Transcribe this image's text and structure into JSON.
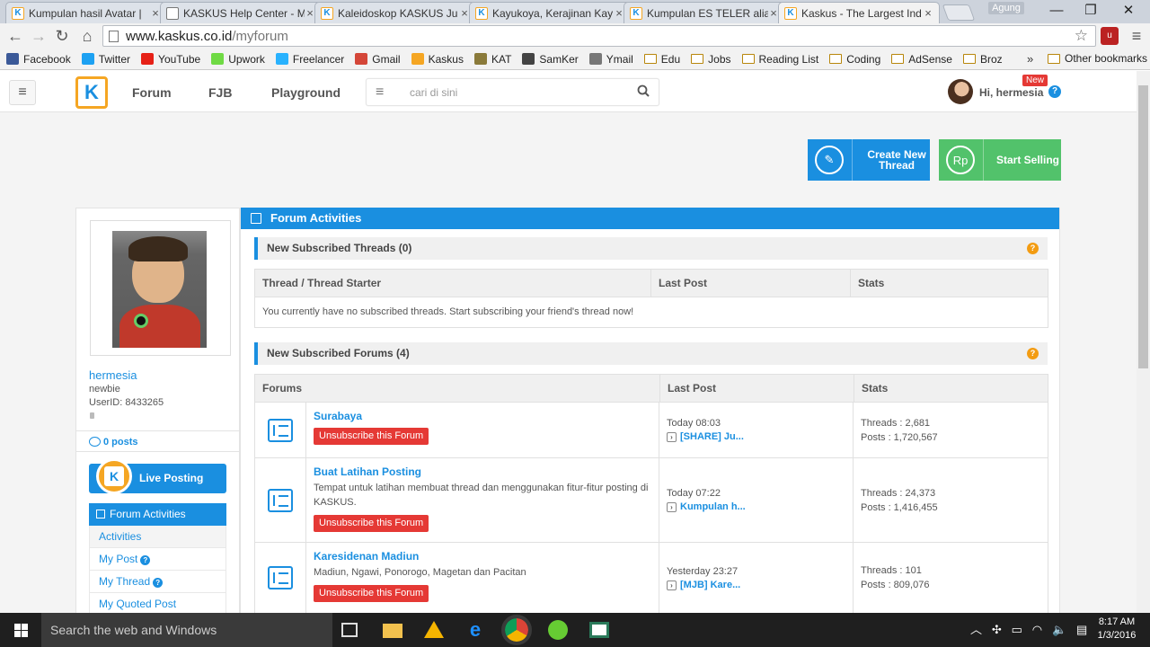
{
  "browser": {
    "tabs": [
      {
        "title": "Kumpulan hasil Avatar |",
        "icon": "kaskus-icon"
      },
      {
        "title": "KASKUS Help Center - M",
        "icon": "document-icon"
      },
      {
        "title": "Kaleidoskop KASKUS Ju",
        "icon": "kaskus-icon"
      },
      {
        "title": "Kayukoya, Kerajinan Kay",
        "icon": "kaskus-icon"
      },
      {
        "title": "Kumpulan ES TELER alias",
        "icon": "kaskus-icon"
      },
      {
        "title": "Kaskus - The Largest Ind",
        "icon": "kaskus-icon",
        "active": true
      }
    ],
    "profile_name": "Agung",
    "url_host": "www.kaskus.co.id",
    "url_path": "/myforum",
    "bookmarks": [
      {
        "label": "Facebook",
        "color": "#3b5998",
        "glyph": "f"
      },
      {
        "label": "Twitter",
        "color": "#1da1f2",
        "glyph": "t"
      },
      {
        "label": "YouTube",
        "color": "#e62117",
        "glyph": "▶"
      },
      {
        "label": "Upwork",
        "color": "#6fda44",
        "glyph": "up"
      },
      {
        "label": "Freelancer",
        "color": "#29b2fe",
        "glyph": "F"
      },
      {
        "label": "Gmail",
        "color": "#d44638",
        "glyph": "M"
      },
      {
        "label": "Kaskus",
        "color": "#f5a623",
        "glyph": "K"
      },
      {
        "label": "KAT",
        "color": "#8a7a3a",
        "glyph": "K"
      },
      {
        "label": "SamKer",
        "color": "#444",
        "glyph": "S"
      },
      {
        "label": "Ymail",
        "color": "#777",
        "glyph": ""
      },
      {
        "label": "Edu",
        "folder": true
      },
      {
        "label": "Jobs",
        "folder": true
      },
      {
        "label": "Reading List",
        "folder": true
      },
      {
        "label": "Coding",
        "folder": true
      },
      {
        "label": "AdSense",
        "folder": true
      },
      {
        "label": "Broz",
        "folder": true
      }
    ],
    "bookmarks_overflow": "»",
    "other_bookmarks": "Other bookmarks"
  },
  "header": {
    "nav": [
      "Forum",
      "FJB",
      "Playground"
    ],
    "search_placeholder": "cari di sini",
    "greeting": "Hi, hermesia",
    "new_badge": "New",
    "help": "?"
  },
  "actions": {
    "create_label": "Create New Thread",
    "sell_label": "Start Selling",
    "sell_icon_text": "Rp"
  },
  "profile": {
    "username": "hermesia",
    "rank": "newbie",
    "user_id": "UserID: 8433265",
    "posts": "0 posts",
    "live_posting": "Live Posting"
  },
  "sidebar_menu": {
    "heading": "Forum Activities",
    "items": [
      {
        "label": "Activities",
        "help": false
      },
      {
        "label": "My Post",
        "help": true
      },
      {
        "label": "My Thread",
        "help": true
      },
      {
        "label": "My Quoted Post",
        "help": false
      }
    ]
  },
  "main": {
    "heading": "Forum Activities",
    "threads_section": {
      "title": "New Subscribed Threads (0)",
      "columns": [
        "Thread / Thread Starter",
        "Last Post",
        "Stats"
      ],
      "empty_message": "You currently have no subscribed threads. Start subscribing your friend's thread now!"
    },
    "forums_section": {
      "title": "New Subscribed Forums (4)",
      "columns": [
        "Forums",
        "Last Post",
        "Stats"
      ],
      "unsubscribe_label": "Unsubscribe this Forum",
      "rows": [
        {
          "name": "Surabaya",
          "desc": "",
          "last_time": "Today 08:03",
          "last_title": "[SHARE] Ju...",
          "threads": "Threads : 2,681",
          "posts": "Posts : 1,720,567"
        },
        {
          "name": "Buat Latihan Posting",
          "desc": "Tempat untuk latihan membuat thread dan menggunakan fitur-fitur posting di KASKUS.",
          "last_time": "Today 07:22",
          "last_title": "Kumpulan h...",
          "threads": "Threads : 24,373",
          "posts": "Posts : 1,416,455"
        },
        {
          "name": "Karesidenan Madiun",
          "desc": "Madiun, Ngawi, Ponorogo, Magetan dan Pacitan",
          "last_time": "Yesterday 23:27",
          "last_title": "[MJB] Kare...",
          "threads": "Threads : 101",
          "posts": "Posts : 809,076"
        }
      ]
    }
  },
  "taskbar": {
    "search_placeholder": "Search the web and Windows",
    "time": "8:17 AM",
    "date": "1/3/2016"
  },
  "colors": {
    "kaskus_blue": "#1a8fe0",
    "sell_green": "#52c26b",
    "unsubscribe_red": "#e53935",
    "help_orange": "#f39c12"
  }
}
